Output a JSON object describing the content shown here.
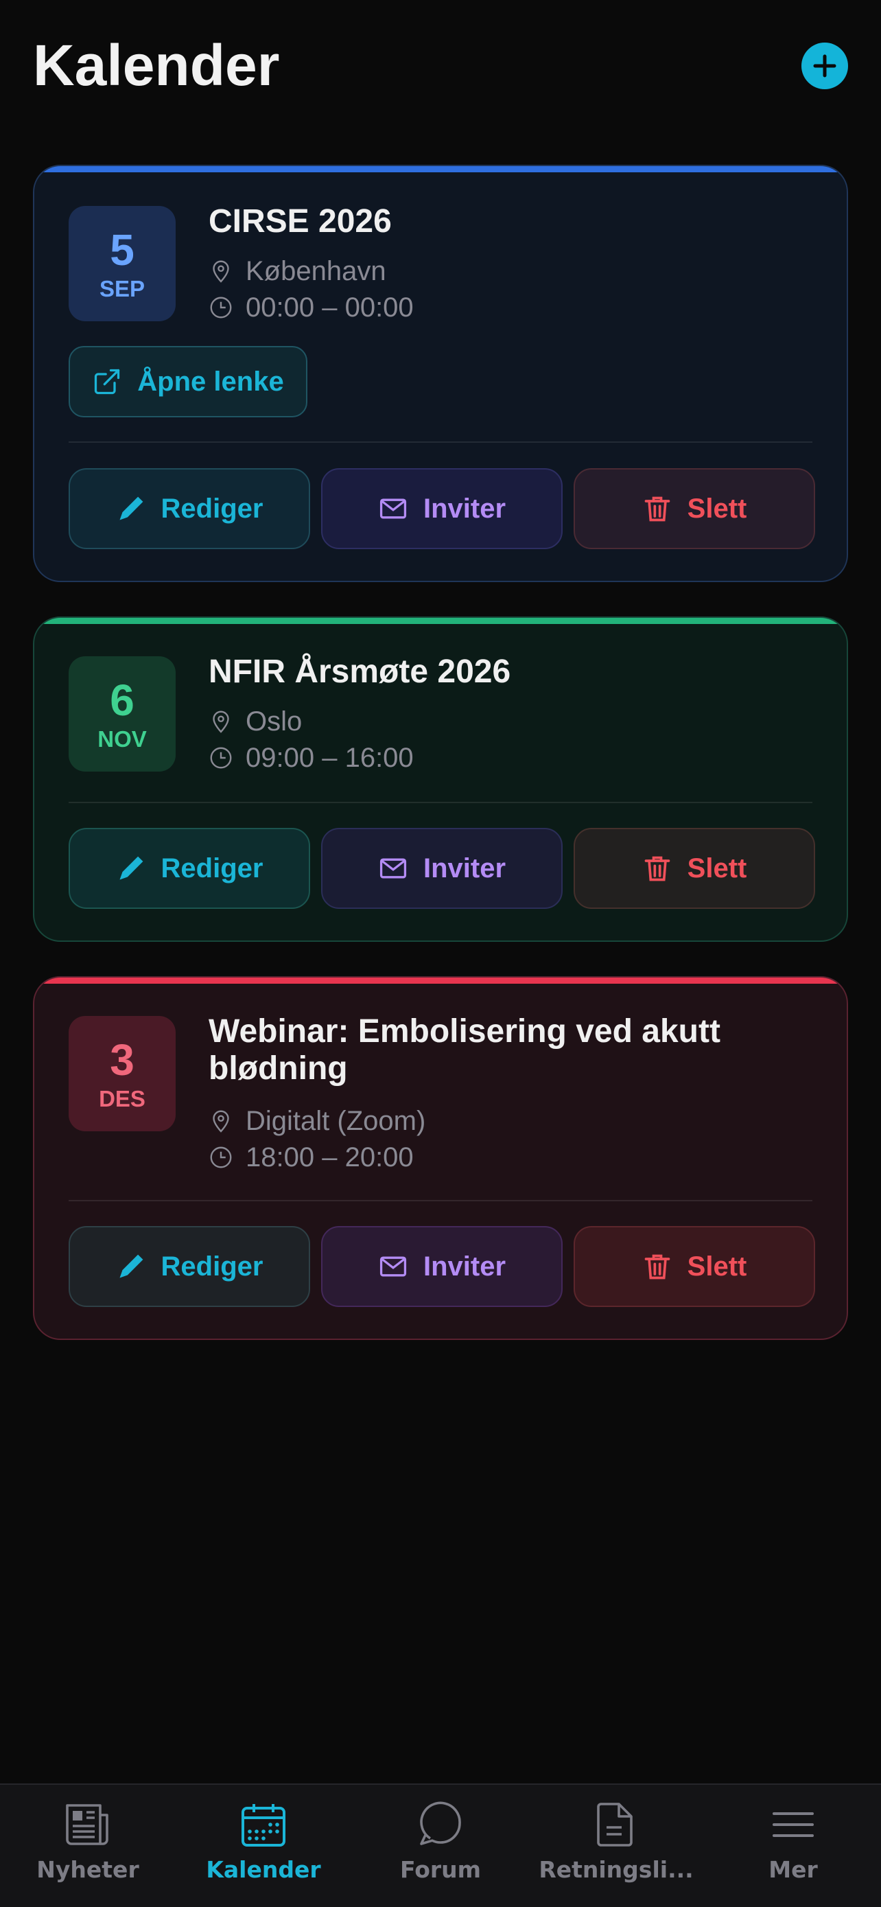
{
  "header": {
    "title": "Kalender",
    "add_icon": "plus-icon"
  },
  "events": [
    {
      "day": "5",
      "month": "SEP",
      "title": "CIRSE 2026",
      "location": "København",
      "time": "00:00 – 00:00",
      "link_label": "Åpne lenke",
      "accent": "#2f6fe0"
    },
    {
      "day": "6",
      "month": "NOV",
      "title": "NFIR Årsmøte 2026",
      "location": "Oslo",
      "time": "09:00 – 16:00",
      "accent": "#22b37a"
    },
    {
      "day": "3",
      "month": "DES",
      "title": "Webinar: Embolisering ved akutt blødning",
      "location": "Digitalt (Zoom)",
      "time": "18:00 – 20:00",
      "accent": "#e8354f"
    }
  ],
  "actions": {
    "edit": "Rediger",
    "invite": "Inviter",
    "delete": "Slett"
  },
  "tabs": [
    {
      "label": "Nyheter",
      "icon": "newspaper-icon",
      "active": false
    },
    {
      "label": "Kalender",
      "icon": "calendar-icon",
      "active": true
    },
    {
      "label": "Forum",
      "icon": "chat-bubble-icon",
      "active": false
    },
    {
      "label": "Retningsli...",
      "icon": "document-icon",
      "active": false
    },
    {
      "label": "Mer",
      "icon": "menu-icon",
      "active": false
    }
  ],
  "colors": {
    "accent": "#14b4d9",
    "background": "#0a0a0a"
  }
}
